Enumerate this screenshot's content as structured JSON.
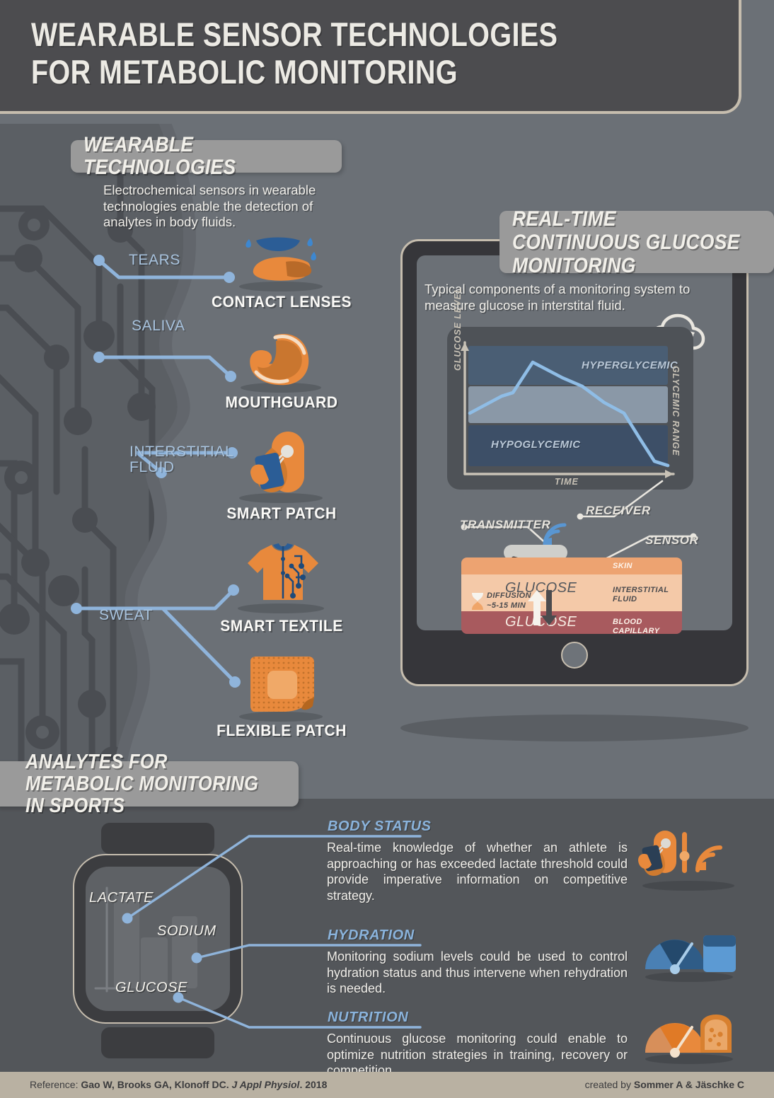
{
  "header": {
    "title": "WEARABLE SENSOR TECHNOLOGIES FOR METABOLIC MONITORING"
  },
  "section_wearable": {
    "pill_title": "WEARABLE TECHNOLOGIES",
    "intro": "Electrochemical sensors in wearable technologies enable the detection of analytes in body fluids.",
    "items": [
      {
        "fluid": "TEARS",
        "device": "CONTACT LENSES",
        "icon": "contact-lens-icon"
      },
      {
        "fluid": "SALIVA",
        "device": "MOUTHGUARD",
        "icon": "mouthguard-icon"
      },
      {
        "fluid": "INTERSTITIAL\nFLUID",
        "device": "SMART PATCH",
        "icon": "smart-patch-icon"
      },
      {
        "fluid": "SWEAT",
        "device": "SMART TEXTILE",
        "icon": "smart-textile-icon"
      },
      {
        "fluid": "",
        "device": "FLEXIBLE PATCH",
        "icon": "flexible-patch-icon"
      }
    ]
  },
  "section_cgm": {
    "pill_title": "REAL-TIME CONTINUOUS GLUCOSE MONITORING",
    "intro": "Typical components of a monitoring system to measure glucose in interstital fluid.",
    "cloud_icon": "cloud-sync-icon",
    "callouts": {
      "transmitter": "TRANSMITTER",
      "receiver": "RECEIVER",
      "sensor": "SENSOR"
    },
    "skin_diagram": {
      "layers": [
        {
          "name": "SKIN",
          "color": "#eda371"
        },
        {
          "name": "INTERSTITIAL FLUID",
          "color": "#f4c9a8"
        },
        {
          "name": "BLOOD CAPILLARY",
          "color": "#a85a5e"
        }
      ],
      "glucose_upper": "GLUCOSE",
      "glucose_lower": "GLUCOSE",
      "diffusion_line1": "DIFFUSION",
      "diffusion_line2": "~5-15 MIN",
      "hourglass_icon": "hourglass-icon",
      "wifi_icon": "wifi-signal-icon"
    }
  },
  "chart_data": {
    "type": "line",
    "title": "",
    "xlabel": "TIME",
    "ylabel": "GLUCOSE LEVEL",
    "right_label": "GLYCEMIC RANGE",
    "bands": [
      {
        "label": "HYPERGLYCEMIC",
        "color": "#4a5e74",
        "range": [
          0.72,
          1.0
        ]
      },
      {
        "label": "",
        "color": "#8a98a7",
        "range": [
          0.44,
          0.72
        ]
      },
      {
        "label": "HYPOGLYCEMIC",
        "color": "#3d4f67",
        "range": [
          0.1,
          0.44
        ]
      }
    ],
    "series": [
      {
        "name": "glucose",
        "color": "#8fbde6",
        "x": [
          0.0,
          0.16,
          0.22,
          0.32,
          0.47,
          0.57,
          0.68,
          0.78,
          0.86,
          0.93,
          1.0
        ],
        "y": [
          0.52,
          0.66,
          0.69,
          0.92,
          0.8,
          0.73,
          0.61,
          0.52,
          0.39,
          0.28,
          0.25
        ]
      }
    ],
    "grid": false,
    "legend_position": "none"
  },
  "section_analytes": {
    "pill_title": "ANALYTES FOR METABOLIC MONITORING IN SPORTS",
    "watch_labels": [
      "LACTATE",
      "SODIUM",
      "GLUCOSE"
    ],
    "watch_bars": [
      {
        "name": "LACTATE",
        "height": 0.82
      },
      {
        "name": "SODIUM",
        "height": 0.58
      },
      {
        "name": "GLUCOSE",
        "height": 0.4
      }
    ],
    "topics": [
      {
        "heading": "BODY STATUS",
        "text": "Real-time knowledge of whether an athlete is approaching or has exceeded lactate threshold could provide imperative information on competitive strategy.",
        "icon": "smart-patch-wifi-icon"
      },
      {
        "heading": "HYDRATION",
        "text": "Monitoring sodium levels could be used to control hydration status and thus intervene when rehydration is needed.",
        "icon": "gauge-water-glass-icon"
      },
      {
        "heading": "NUTRITION",
        "text": "Continuous glucose monitoring could enable to optimize nutrition strategies in training, recovery or competition.",
        "icon": "gauge-bread-icon"
      }
    ]
  },
  "footer": {
    "ref_prefix": "Reference: ",
    "ref_authors": "Gao W,  Brooks GA, Klonoff DC. ",
    "ref_journal": "J Appl Physiol",
    "ref_year": ". 2018",
    "credit_prefix": "created by ",
    "credit_names": "Sommer A & Jäschke C"
  },
  "colors": {
    "background": "#6b7076",
    "header_panel": "#4c4c4f",
    "accent_tan": "#c6bdae",
    "accent_blue": "#8ab3dc",
    "accent_orange": "#e8893c",
    "bottom_band": "#53565a",
    "footer": "#b9b1a2"
  }
}
